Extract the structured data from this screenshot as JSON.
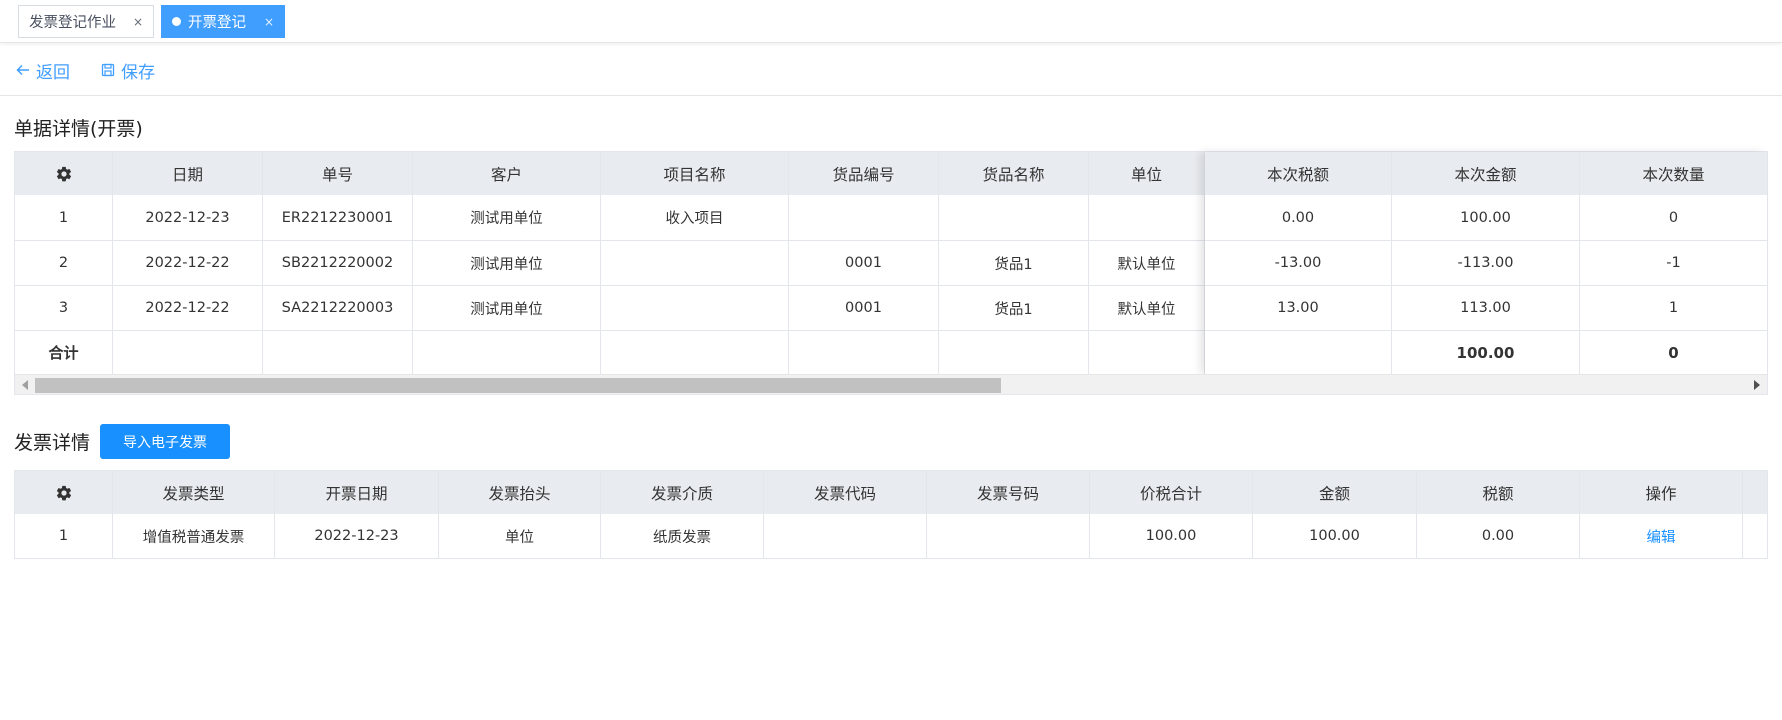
{
  "tabs": [
    {
      "label": "发票登记作业",
      "close": "×",
      "active": false
    },
    {
      "label": "开票登记",
      "close": "×",
      "active": true
    }
  ],
  "toolbar": {
    "back_label": "返回",
    "save_label": "保存"
  },
  "section1": {
    "title": "单据详情(开票)",
    "columns": [
      "日期",
      "单号",
      "客户",
      "项目名称",
      "货品编号",
      "货品名称",
      "单位",
      "本次税额",
      "本次金额",
      "本次数量"
    ],
    "rows": [
      {
        "idx": "1",
        "date": "2022-12-23",
        "no": "ER2212230001",
        "customer": "测试用单位",
        "project": "收入项目",
        "code": "",
        "name": "",
        "unit": "",
        "tax": "0.00",
        "amount": "100.00",
        "qty": "0"
      },
      {
        "idx": "2",
        "date": "2022-12-22",
        "no": "SB2212220002",
        "customer": "测试用单位",
        "project": "",
        "code": "0001",
        "name": "货品1",
        "unit": "默认单位",
        "tax": "-13.00",
        "amount": "-113.00",
        "qty": "-1"
      },
      {
        "idx": "3",
        "date": "2022-12-22",
        "no": "SA2212220003",
        "customer": "测试用单位",
        "project": "",
        "code": "0001",
        "name": "货品1",
        "unit": "默认单位",
        "tax": "13.00",
        "amount": "113.00",
        "qty": "1"
      }
    ],
    "summary": {
      "label": "合计",
      "amount": "100.00",
      "qty": "0"
    }
  },
  "section2": {
    "title": "发票详情",
    "import_label": "导入电子发票",
    "columns": [
      "发票类型",
      "开票日期",
      "发票抬头",
      "发票介质",
      "发票代码",
      "发票号码",
      "价税合计",
      "金额",
      "税额",
      "操作"
    ],
    "rows": [
      {
        "idx": "1",
        "type": "增值税普通发票",
        "date": "2022-12-23",
        "header": "单位",
        "medium": "纸质发票",
        "code": "",
        "number": "",
        "total": "100.00",
        "amount": "100.00",
        "tax": "0.00",
        "action": "编辑"
      }
    ]
  },
  "colors": {
    "accent": "#409eff",
    "primary_button": "#1890ff",
    "header_bg": "#e8ebef"
  }
}
